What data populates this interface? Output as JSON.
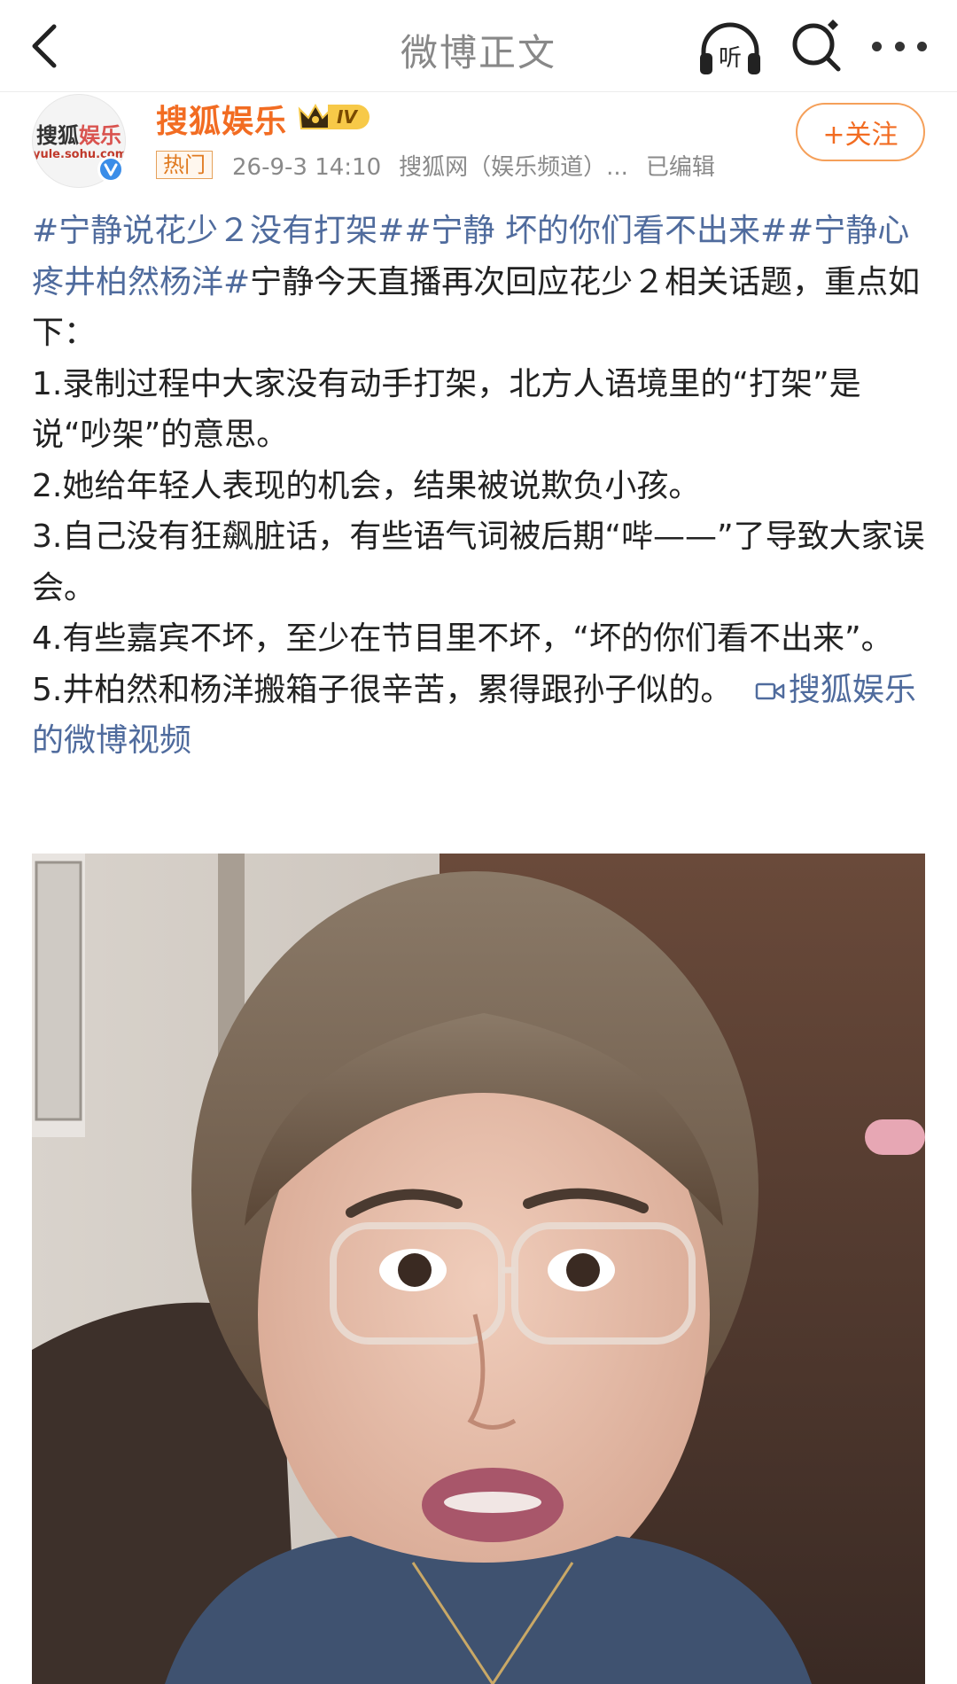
{
  "nav": {
    "title": "微博正文",
    "back_icon": "back-arrow-icon",
    "listen_label": "听",
    "search_icon": "search-icon",
    "more_icon": "more-dots-icon"
  },
  "author": {
    "avatar_text_top_1": "搜狐",
    "avatar_text_top_2": "娱乐",
    "avatar_text_bottom": "yule.sohu.com",
    "name": "搜狐娱乐",
    "level": "IV",
    "hot_tag": "热门",
    "date": "26-9-3 14:10",
    "source": "搜狐网（娱乐频道）...",
    "edited": "已编辑",
    "follow_label": "+关注"
  },
  "post": {
    "tag1": "#宁静说花少２没有打架#",
    "tag2": "#宁静 坏的你们看不出来#",
    "tag3": "#宁静心疼井柏然杨洋#",
    "intro": "宁静今天直播再次回应花少２相关话题，重点如下：",
    "point1": "1.录制过程中大家没有动手打架，北方人语境里的“打架”是说“吵架”的意思。",
    "point2": "2.她给年轻人表现的机会，结果被说欺负小孩。",
    "point3": "3.自己没有狂飙脏话，有些语气词被后期“哔——”了导致大家误会。",
    "point4": "4.有些嘉宾不坏，至少在节目里不坏，“坏的你们看不出来”。",
    "point5": "5.井柏然和杨洋搬箱子很辛苦，累得跟孙子似的。",
    "video_link": "搜狐娱乐的微博视频"
  },
  "colors": {
    "accent_orange": "#f26c22",
    "link_blue": "#4f6b9d"
  }
}
